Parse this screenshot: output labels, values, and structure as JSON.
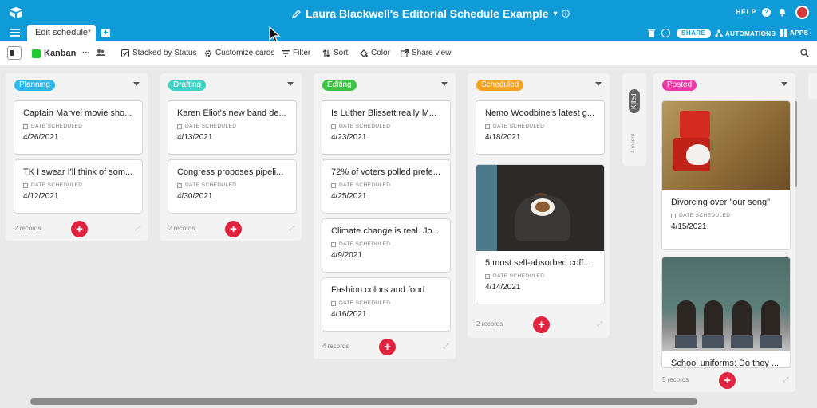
{
  "header": {
    "title": "Laura Blackwell's Editorial Schedule Example",
    "help_label": "HELP",
    "share_label": "SHARE",
    "automations_label": "AUTOMATIONS",
    "apps_label": "APPS"
  },
  "tabs": [
    {
      "label": "Edit schedule"
    }
  ],
  "toolbar": {
    "view_name": "Kanban",
    "stacked_label": "Stacked by Status",
    "customize_label": "Customize cards",
    "filter_label": "Filter",
    "sort_label": "Sort",
    "color_label": "Color",
    "share_view_label": "Share view"
  },
  "field_label": "DATE SCHEDULED",
  "columns": [
    {
      "name": "Planning",
      "color": "#2db8ee",
      "count_label": "2 records",
      "cards": [
        {
          "title": "Captain Marvel movie sho...",
          "date": "4/26/2021"
        },
        {
          "title": "TK I swear I'll think of som...",
          "date": "4/12/2021"
        }
      ]
    },
    {
      "name": "Drafting",
      "color": "#3fd4c5",
      "count_label": "2 records",
      "cards": [
        {
          "title": "Karen Eliot's new band de...",
          "date": "4/13/2021"
        },
        {
          "title": "Congress proposes pipeli...",
          "date": "4/30/2021"
        }
      ]
    },
    {
      "name": "Editing",
      "color": "#3ec444",
      "count_label": "4 records",
      "cards": [
        {
          "title": "Is Luther Blissett really M...",
          "date": "4/23/2021"
        },
        {
          "title": "72% of voters polled prefe...",
          "date": "4/25/2021"
        },
        {
          "title": "Climate change is real. Jo...",
          "date": "4/9/2021"
        },
        {
          "title": "Fashion colors and food",
          "date": "4/16/2021"
        }
      ]
    },
    {
      "name": "Scheduled",
      "color": "#f7a21e",
      "count_label": "2 records",
      "cards": [
        {
          "title": "Nemo Woodbine's latest g...",
          "date": "4/18/2021"
        },
        {
          "title": "5 most self-absorbed coff...",
          "date": "4/14/2021"
        }
      ]
    },
    {
      "name": "Killed",
      "color": "#666666",
      "count_label": "1 record",
      "cards": []
    },
    {
      "name": "Posted",
      "color": "#ee3aa6",
      "count_label": "5 records",
      "cards": [
        {
          "title": "Divorcing over \"our song\"",
          "date": "4/15/2021"
        },
        {
          "title": "School uniforms: Do they ...",
          "date": ""
        }
      ]
    }
  ],
  "icons": [
    "airtable-logo-icon",
    "pencil-icon",
    "info-icon",
    "question-icon",
    "bell-icon",
    "menu-icon",
    "plus-icon",
    "trash-icon",
    "history-icon",
    "automations-icon",
    "apps-icon",
    "sidebar-toggle-icon",
    "kanban-icon",
    "more-icon",
    "people-icon",
    "checkbox-icon",
    "gear-icon",
    "filter-icon",
    "sort-icon",
    "paint-bucket-icon",
    "share-view-icon",
    "search-icon",
    "calendar-icon",
    "expand-icon"
  ],
  "colors": {
    "header": "#0f9bd7",
    "add_button": "#e02440",
    "board_bg": "#e9e9e9"
  }
}
